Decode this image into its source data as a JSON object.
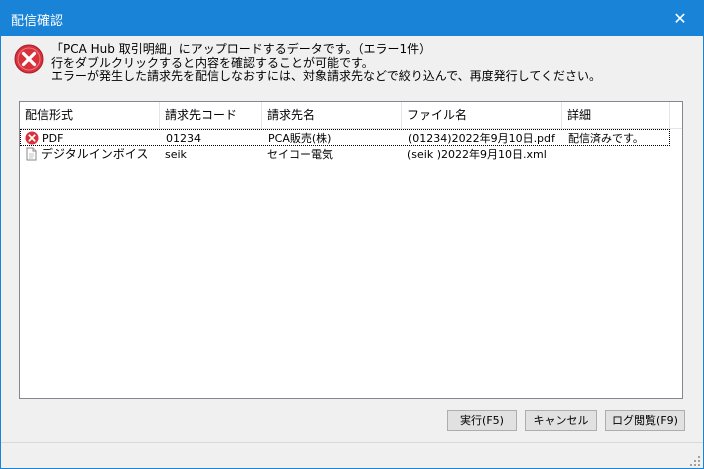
{
  "window": {
    "title": "配信確認",
    "close_glyph": "✕"
  },
  "message": {
    "line1": "「PCA Hub 取引明細」にアップロードするデータです。（エラー1件）",
    "line2": "行をダブルクリックすると内容を確認することが可能です。",
    "line3": "エラーが発生した請求先を配信しなおすには、対象請求先などで絞り込んで、再度発行してください。",
    "icon": "error-icon",
    "icon_color": "#d9303b"
  },
  "table": {
    "columns": [
      "配信形式",
      "請求先コード",
      "請求先名",
      "ファイル名",
      "詳細"
    ],
    "rows": [
      {
        "icon": "error-icon",
        "format": "PDF",
        "code": "01234",
        "name": "PCA販売(株)",
        "file": "(01234)2022年9月10日.pdf",
        "detail": "配信済みです。",
        "selected": true
      },
      {
        "icon": "document-icon",
        "format": "デジタルインボイス",
        "code": "seik",
        "name": "セイコー電気",
        "file": "(seik )2022年9月10日.xml",
        "detail": "",
        "selected": false
      }
    ]
  },
  "buttons": {
    "execute": "実行(F5)",
    "cancel": "キャンセル",
    "log": "ログ閲覧(F9)"
  },
  "colors": {
    "titlebar": "#1883d7",
    "error": "#d9303b"
  }
}
